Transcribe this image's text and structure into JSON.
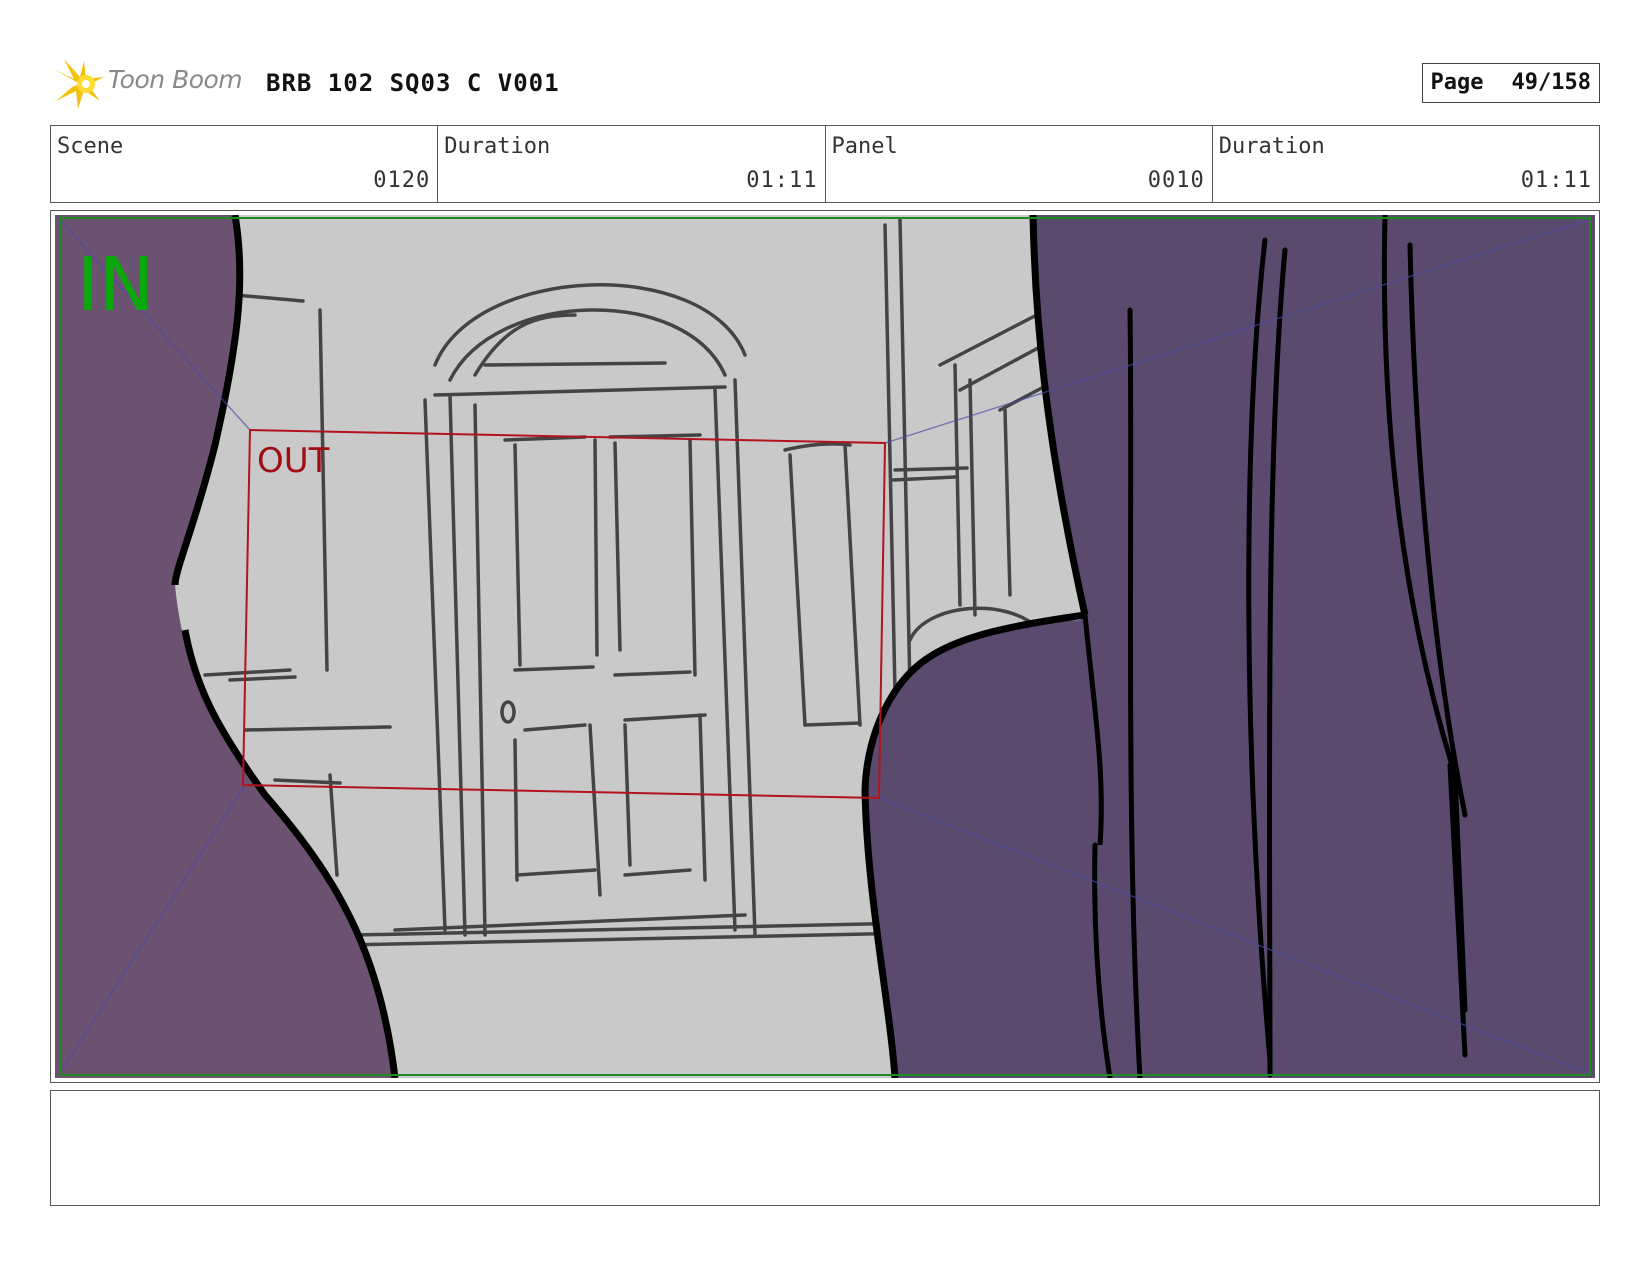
{
  "header": {
    "logo_text": "Toon Boom",
    "title": "BRB 102 SQ03 C V001",
    "page_label": "Page",
    "page_number": "49/158"
  },
  "info": [
    {
      "label": "Scene",
      "value": "0120"
    },
    {
      "label": "Duration",
      "value": "01:11"
    },
    {
      "label": "Panel",
      "value": "0010"
    },
    {
      "label": "Duration",
      "value": "01:11"
    }
  ],
  "panel": {
    "in_label": "IN",
    "out_label": "OUT",
    "colors": {
      "in_frame": "#1f8a1f",
      "out_frame": "#b3131b",
      "in_text": "#0aa80a",
      "out_text": "#a00d12",
      "left_curtain": "#6b5270",
      "right_curtain": "#5a4b6e",
      "background": "#c9c9c9",
      "sketch": "#444444"
    }
  },
  "notes": {
    "text": ""
  }
}
